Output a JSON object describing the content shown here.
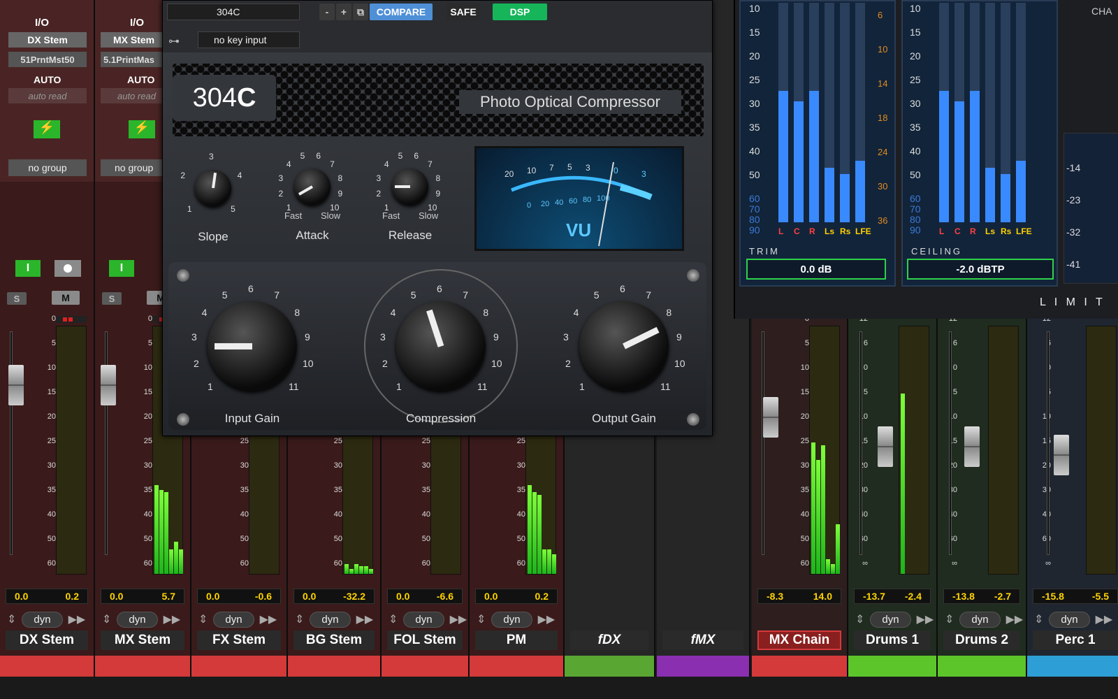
{
  "left_sections": {
    "io": "I/O",
    "auto": "AUTO",
    "strip1": {
      "output": "DX Stem",
      "send": "51PrntMst50",
      "auto_mode": "auto read",
      "group": "no group"
    },
    "strip2": {
      "output": "MX Stem",
      "send": "5.1PrintMas",
      "auto_mode": "auto read",
      "group": "no group"
    }
  },
  "buttons": {
    "s": "S",
    "m": "M",
    "i": "I"
  },
  "scale": [
    "0",
    "5",
    "10",
    "15",
    "20",
    "25",
    "30",
    "35",
    "40",
    "50",
    "60"
  ],
  "scale_alt": [
    "12",
    "6",
    "0",
    "5",
    "10",
    "15",
    "20",
    "30",
    "40",
    "60",
    "∞"
  ],
  "strips": [
    {
      "name": "DX Stem",
      "vol": "0.0",
      "peak": "0.2",
      "dyn": "dyn",
      "color": "#d43a3a"
    },
    {
      "name": "MX Stem",
      "vol": "0.0",
      "peak": "5.7",
      "dyn": "dyn",
      "color": "#d43a3a"
    },
    {
      "name": "FX Stem",
      "vol": "0.0",
      "peak": "-0.6",
      "dyn": "dyn",
      "color": "#d43a3a"
    },
    {
      "name": "BG Stem",
      "vol": "0.0",
      "peak": "-32.2",
      "dyn": "dyn",
      "color": "#d43a3a"
    },
    {
      "name": "FOL Stem",
      "vol": "0.0",
      "peak": "-6.6",
      "dyn": "dyn",
      "color": "#d43a3a"
    },
    {
      "name": "PM",
      "vol": "0.0",
      "peak": "0.2",
      "dyn": "dyn",
      "color": "#d43a3a"
    },
    {
      "name": "fDX",
      "color": "#5aa632"
    },
    {
      "name": "fMX",
      "color": "#8a2fb0"
    },
    {
      "name": "MX Chain",
      "vol": "-8.3",
      "peak": "14.0",
      "color": "#d43a3a"
    },
    {
      "name": "Drums 1",
      "vol": "-13.7",
      "peak": "-2.4",
      "dyn": "dyn",
      "color": "#5cc52a"
    },
    {
      "name": "Drums 2",
      "vol": "-13.8",
      "peak": "-2.7",
      "dyn": "dyn",
      "color": "#5cc52a"
    },
    {
      "name": "Perc 1",
      "vol": "-15.8",
      "peak": "-5.5",
      "dyn": "dyn",
      "color": "#2e9fd6"
    }
  ],
  "plugin": {
    "preset": "304C",
    "minus": "-",
    "plus": "+",
    "compare": "COMPARE",
    "safe": "SAFE",
    "dsp": "DSP",
    "key_input": "no key input",
    "model": "304",
    "model_bold": "C",
    "subtitle": "Photo Optical Compressor",
    "small_knobs": [
      {
        "label": "Slope"
      },
      {
        "label": "Attack",
        "fast": "Fast",
        "slow": "Slow"
      },
      {
        "label": "Release",
        "fast": "Fast",
        "slow": "Slow"
      }
    ],
    "big_knobs": [
      {
        "label": "Input Gain"
      },
      {
        "label": "Compression"
      },
      {
        "label": "Output Gain"
      }
    ],
    "vu_text": "VU",
    "vu_top": [
      "20",
      "10",
      "7",
      "5",
      "3",
      "0",
      "3"
    ],
    "vu_bottom": [
      "0",
      "20",
      "40",
      "60",
      "80",
      "100"
    ],
    "big_scale": [
      "1",
      "2",
      "3",
      "4",
      "5",
      "6",
      "7",
      "8",
      "9",
      "10",
      "11"
    ],
    "small_scale": [
      "1",
      "2",
      "3",
      "4",
      "5"
    ],
    "ar_scale": [
      "1",
      "2",
      "3",
      "4",
      "5",
      "6",
      "7",
      "8",
      "9",
      "10"
    ]
  },
  "limiter": {
    "scale": [
      "10",
      "15",
      "20",
      "25",
      "30",
      "35",
      "40",
      "50",
      "60",
      "70",
      "80",
      "90"
    ],
    "gr": [
      "6",
      "10",
      "14",
      "18",
      "24",
      "30",
      "36"
    ],
    "channels": [
      "L",
      "C",
      "R",
      "Ls",
      "Rs",
      "LFE"
    ],
    "trim_label": "TRIM",
    "trim_value": "0.0 dB",
    "ceiling_label": "CEILING",
    "ceiling_value": "-2.0 dBTP",
    "brand": "L I M I T",
    "cha": "CHA",
    "side": [
      "-14",
      "-23",
      "-32",
      "-41"
    ]
  },
  "misc": {
    "up": "up",
    "m": "M"
  }
}
